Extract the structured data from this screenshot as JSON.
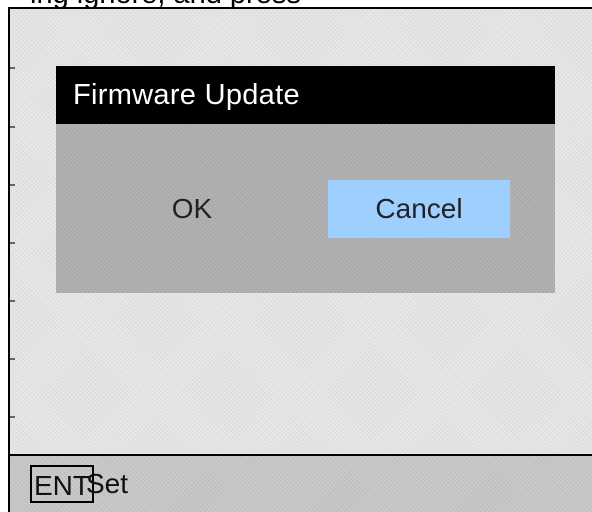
{
  "cut_text": "ing ignore, and press",
  "dialog": {
    "title": "Firmware  Update",
    "ok_label": "OK",
    "cancel_label": "Cancel",
    "selected": "Cancel",
    "selected_color": "#9fcfff"
  },
  "status_bar": {
    "key": "ENT",
    "action": "Set"
  }
}
